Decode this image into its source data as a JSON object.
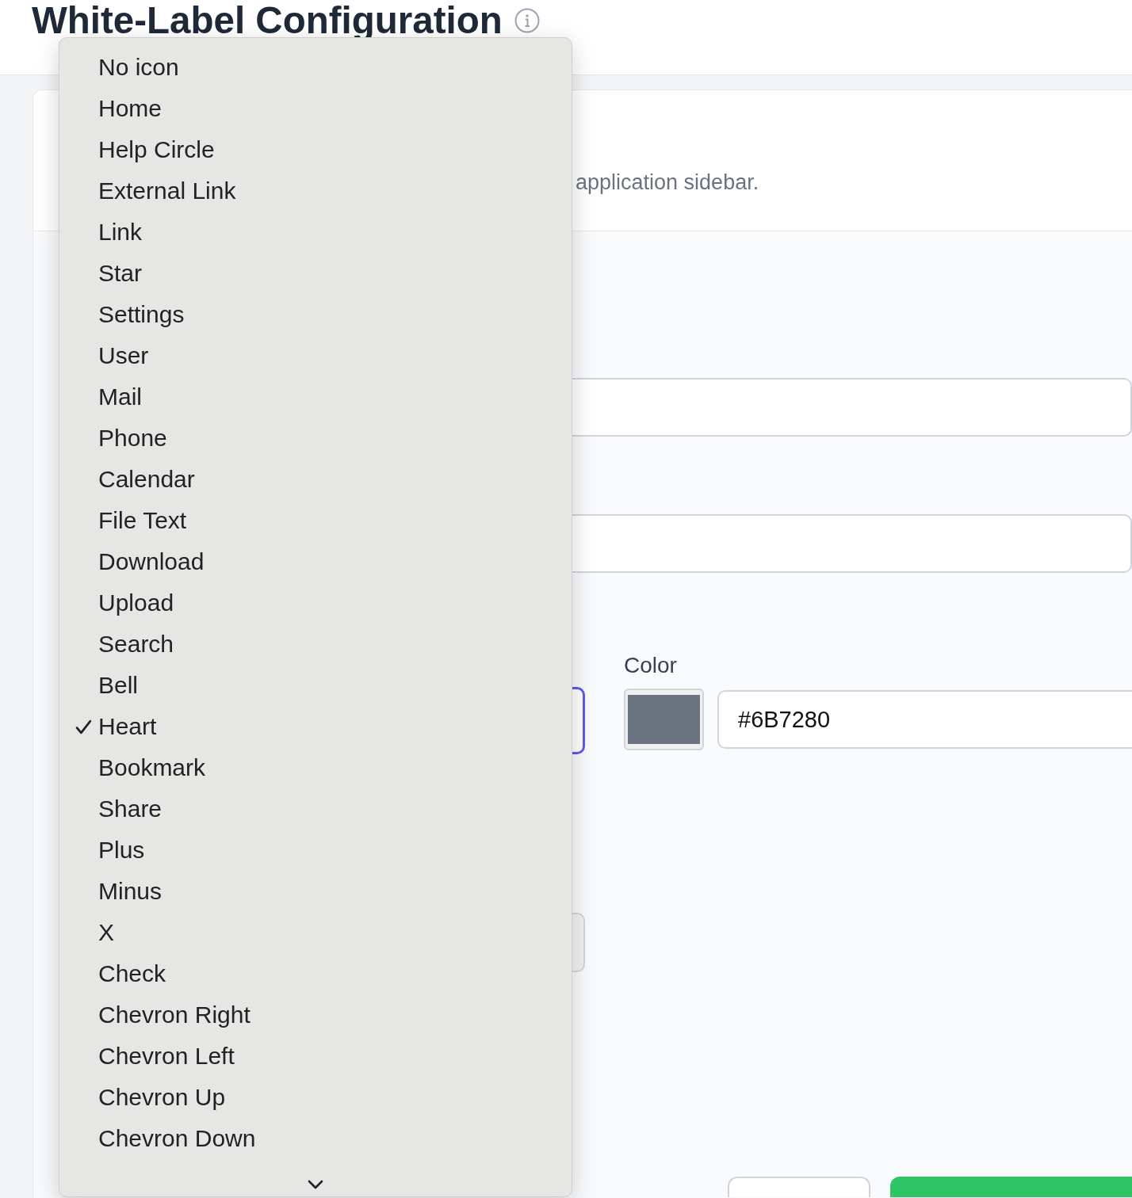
{
  "header": {
    "title": "White-Label Configuration"
  },
  "card": {
    "description": "application sidebar.",
    "icon_field": {
      "focused": true
    },
    "color_field": {
      "label": "Color",
      "value": "#6B7280"
    }
  },
  "icon_menu": {
    "options": [
      {
        "label": "No icon",
        "selected": false
      },
      {
        "label": "Home",
        "selected": false
      },
      {
        "label": "Help Circle",
        "selected": false
      },
      {
        "label": "External Link",
        "selected": false
      },
      {
        "label": "Link",
        "selected": false
      },
      {
        "label": "Star",
        "selected": false
      },
      {
        "label": "Settings",
        "selected": false
      },
      {
        "label": "User",
        "selected": false
      },
      {
        "label": "Mail",
        "selected": false
      },
      {
        "label": "Phone",
        "selected": false
      },
      {
        "label": "Calendar",
        "selected": false
      },
      {
        "label": "File Text",
        "selected": false
      },
      {
        "label": "Download",
        "selected": false
      },
      {
        "label": "Upload",
        "selected": false
      },
      {
        "label": "Search",
        "selected": false
      },
      {
        "label": "Bell",
        "selected": false
      },
      {
        "label": "Heart",
        "selected": true
      },
      {
        "label": "Bookmark",
        "selected": false
      },
      {
        "label": "Share",
        "selected": false
      },
      {
        "label": "Plus",
        "selected": false
      },
      {
        "label": "Minus",
        "selected": false
      },
      {
        "label": "X",
        "selected": false
      },
      {
        "label": "Check",
        "selected": false
      },
      {
        "label": "Chevron Right",
        "selected": false
      },
      {
        "label": "Chevron Left",
        "selected": false
      },
      {
        "label": "Chevron Up",
        "selected": false
      },
      {
        "label": "Chevron Down",
        "selected": false
      }
    ],
    "more_below": true
  }
}
